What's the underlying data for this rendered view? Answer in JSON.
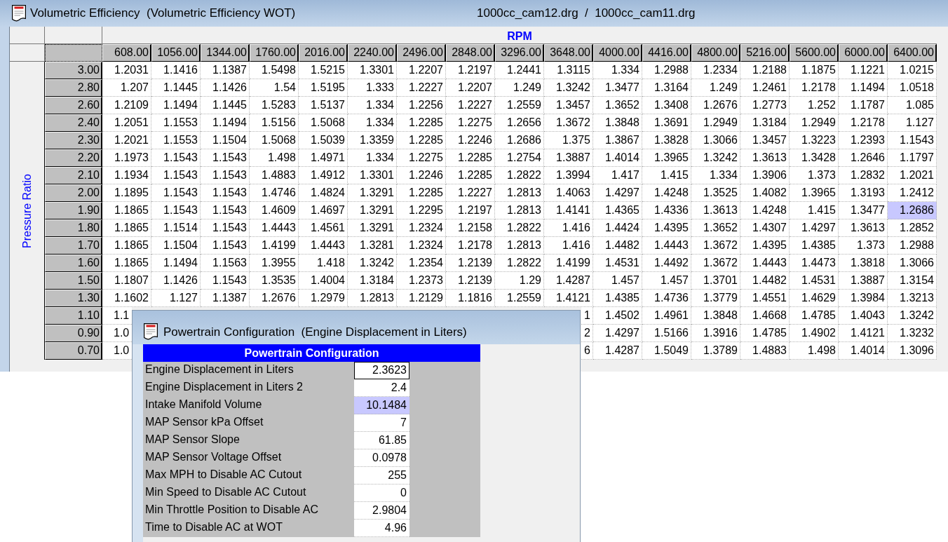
{
  "window": {
    "title": "Volumetric Efficiency  (Volumetric Efficiency WOT)",
    "files": "1000cc_cam12.drg  /  1000cc_cam11.drg"
  },
  "table": {
    "column_axis": "RPM",
    "row_axis": "Pressure Ratio",
    "columns": [
      "608.00",
      "1056.00",
      "1344.00",
      "1760.00",
      "2016.00",
      "2240.00",
      "2496.00",
      "2848.00",
      "3296.00",
      "3648.00",
      "4000.00",
      "4416.00",
      "4800.00",
      "5216.00",
      "5600.00",
      "6000.00",
      "6400.00"
    ],
    "rows": [
      {
        "label": "3.00",
        "kind": "full",
        "cells": [
          {
            "text": "1.2031",
            "selected": false
          },
          {
            "text": "1.1416",
            "selected": false
          },
          {
            "text": "1.1387",
            "selected": false
          },
          {
            "text": "1.5498",
            "selected": false
          },
          {
            "text": "1.5215",
            "selected": false
          },
          {
            "text": "1.3301",
            "selected": false
          },
          {
            "text": "1.2207",
            "selected": false
          },
          {
            "text": "1.2197",
            "selected": false
          },
          {
            "text": "1.2441",
            "selected": false
          },
          {
            "text": "1.3115",
            "selected": false
          },
          {
            "text": "1.334",
            "selected": false
          },
          {
            "text": "1.2988",
            "selected": false
          },
          {
            "text": "1.2334",
            "selected": false
          },
          {
            "text": "1.2188",
            "selected": false
          },
          {
            "text": "1.1875",
            "selected": false
          },
          {
            "text": "1.1221",
            "selected": false
          },
          {
            "text": "1.0215",
            "selected": false
          }
        ]
      },
      {
        "label": "2.80",
        "kind": "full",
        "cells": [
          {
            "text": "1.207",
            "selected": false
          },
          {
            "text": "1.1445",
            "selected": false
          },
          {
            "text": "1.1426",
            "selected": false
          },
          {
            "text": "1.54",
            "selected": false
          },
          {
            "text": "1.5195",
            "selected": false
          },
          {
            "text": "1.333",
            "selected": false
          },
          {
            "text": "1.2227",
            "selected": false
          },
          {
            "text": "1.2207",
            "selected": false
          },
          {
            "text": "1.249",
            "selected": false
          },
          {
            "text": "1.3242",
            "selected": false
          },
          {
            "text": "1.3477",
            "selected": false
          },
          {
            "text": "1.3164",
            "selected": false
          },
          {
            "text": "1.249",
            "selected": false
          },
          {
            "text": "1.2461",
            "selected": false
          },
          {
            "text": "1.2178",
            "selected": false
          },
          {
            "text": "1.1494",
            "selected": false
          },
          {
            "text": "1.0518",
            "selected": false
          }
        ]
      },
      {
        "label": "2.60",
        "kind": "full",
        "cells": [
          {
            "text": "1.2109",
            "selected": false
          },
          {
            "text": "1.1494",
            "selected": false
          },
          {
            "text": "1.1445",
            "selected": false
          },
          {
            "text": "1.5283",
            "selected": false
          },
          {
            "text": "1.5137",
            "selected": false
          },
          {
            "text": "1.334",
            "selected": false
          },
          {
            "text": "1.2256",
            "selected": false
          },
          {
            "text": "1.2227",
            "selected": false
          },
          {
            "text": "1.2559",
            "selected": false
          },
          {
            "text": "1.3457",
            "selected": false
          },
          {
            "text": "1.3652",
            "selected": false
          },
          {
            "text": "1.3408",
            "selected": false
          },
          {
            "text": "1.2676",
            "selected": false
          },
          {
            "text": "1.2773",
            "selected": false
          },
          {
            "text": "1.252",
            "selected": false
          },
          {
            "text": "1.1787",
            "selected": false
          },
          {
            "text": "1.085",
            "selected": false
          }
        ]
      },
      {
        "label": "2.40",
        "kind": "full",
        "cells": [
          {
            "text": "1.2051",
            "selected": false
          },
          {
            "text": "1.1553",
            "selected": false
          },
          {
            "text": "1.1494",
            "selected": false
          },
          {
            "text": "1.5156",
            "selected": false
          },
          {
            "text": "1.5068",
            "selected": false
          },
          {
            "text": "1.334",
            "selected": false
          },
          {
            "text": "1.2285",
            "selected": false
          },
          {
            "text": "1.2275",
            "selected": false
          },
          {
            "text": "1.2656",
            "selected": false
          },
          {
            "text": "1.3672",
            "selected": false
          },
          {
            "text": "1.3848",
            "selected": false
          },
          {
            "text": "1.3691",
            "selected": false
          },
          {
            "text": "1.2949",
            "selected": false
          },
          {
            "text": "1.3184",
            "selected": false
          },
          {
            "text": "1.2949",
            "selected": false
          },
          {
            "text": "1.2178",
            "selected": false
          },
          {
            "text": "1.127",
            "selected": false
          }
        ]
      },
      {
        "label": "2.30",
        "kind": "full",
        "cells": [
          {
            "text": "1.2021",
            "selected": false
          },
          {
            "text": "1.1553",
            "selected": false
          },
          {
            "text": "1.1504",
            "selected": false
          },
          {
            "text": "1.5068",
            "selected": false
          },
          {
            "text": "1.5039",
            "selected": false
          },
          {
            "text": "1.3359",
            "selected": false
          },
          {
            "text": "1.2285",
            "selected": false
          },
          {
            "text": "1.2246",
            "selected": false
          },
          {
            "text": "1.2686",
            "selected": false
          },
          {
            "text": "1.375",
            "selected": false
          },
          {
            "text": "1.3867",
            "selected": false
          },
          {
            "text": "1.3828",
            "selected": false
          },
          {
            "text": "1.3066",
            "selected": false
          },
          {
            "text": "1.3457",
            "selected": false
          },
          {
            "text": "1.3223",
            "selected": false
          },
          {
            "text": "1.2393",
            "selected": false
          },
          {
            "text": "1.1543",
            "selected": false
          }
        ]
      },
      {
        "label": "2.20",
        "kind": "full",
        "cells": [
          {
            "text": "1.1973",
            "selected": false
          },
          {
            "text": "1.1543",
            "selected": false
          },
          {
            "text": "1.1543",
            "selected": false
          },
          {
            "text": "1.498",
            "selected": false
          },
          {
            "text": "1.4971",
            "selected": false
          },
          {
            "text": "1.334",
            "selected": false
          },
          {
            "text": "1.2275",
            "selected": false
          },
          {
            "text": "1.2285",
            "selected": false
          },
          {
            "text": "1.2754",
            "selected": false
          },
          {
            "text": "1.3887",
            "selected": false
          },
          {
            "text": "1.4014",
            "selected": false
          },
          {
            "text": "1.3965",
            "selected": false
          },
          {
            "text": "1.3242",
            "selected": false
          },
          {
            "text": "1.3613",
            "selected": false
          },
          {
            "text": "1.3428",
            "selected": false
          },
          {
            "text": "1.2646",
            "selected": false
          },
          {
            "text": "1.1797",
            "selected": false
          }
        ]
      },
      {
        "label": "2.10",
        "kind": "full",
        "cells": [
          {
            "text": "1.1934",
            "selected": false
          },
          {
            "text": "1.1543",
            "selected": false
          },
          {
            "text": "1.1543",
            "selected": false
          },
          {
            "text": "1.4883",
            "selected": false
          },
          {
            "text": "1.4912",
            "selected": false
          },
          {
            "text": "1.3301",
            "selected": false
          },
          {
            "text": "1.2246",
            "selected": false
          },
          {
            "text": "1.2285",
            "selected": false
          },
          {
            "text": "1.2822",
            "selected": false
          },
          {
            "text": "1.3994",
            "selected": false
          },
          {
            "text": "1.417",
            "selected": false
          },
          {
            "text": "1.415",
            "selected": false
          },
          {
            "text": "1.334",
            "selected": false
          },
          {
            "text": "1.3906",
            "selected": false
          },
          {
            "text": "1.373",
            "selected": false
          },
          {
            "text": "1.2832",
            "selected": false
          },
          {
            "text": "1.2021",
            "selected": false
          }
        ]
      },
      {
        "label": "2.00",
        "kind": "full",
        "cells": [
          {
            "text": "1.1895",
            "selected": false
          },
          {
            "text": "1.1543",
            "selected": false
          },
          {
            "text": "1.1543",
            "selected": false
          },
          {
            "text": "1.4746",
            "selected": false
          },
          {
            "text": "1.4824",
            "selected": false
          },
          {
            "text": "1.3291",
            "selected": false
          },
          {
            "text": "1.2285",
            "selected": false
          },
          {
            "text": "1.2227",
            "selected": false
          },
          {
            "text": "1.2813",
            "selected": false
          },
          {
            "text": "1.4063",
            "selected": false
          },
          {
            "text": "1.4297",
            "selected": false
          },
          {
            "text": "1.4248",
            "selected": false
          },
          {
            "text": "1.3525",
            "selected": false
          },
          {
            "text": "1.4082",
            "selected": false
          },
          {
            "text": "1.3965",
            "selected": false
          },
          {
            "text": "1.3193",
            "selected": false
          },
          {
            "text": "1.2412",
            "selected": false
          }
        ]
      },
      {
        "label": "1.90",
        "kind": "full",
        "cells": [
          {
            "text": "1.1865",
            "selected": false
          },
          {
            "text": "1.1543",
            "selected": false
          },
          {
            "text": "1.1543",
            "selected": false
          },
          {
            "text": "1.4609",
            "selected": false
          },
          {
            "text": "1.4697",
            "selected": false
          },
          {
            "text": "1.3291",
            "selected": false
          },
          {
            "text": "1.2295",
            "selected": false
          },
          {
            "text": "1.2197",
            "selected": false
          },
          {
            "text": "1.2813",
            "selected": false
          },
          {
            "text": "1.4141",
            "selected": false
          },
          {
            "text": "1.4365",
            "selected": false
          },
          {
            "text": "1.4336",
            "selected": false
          },
          {
            "text": "1.3613",
            "selected": false
          },
          {
            "text": "1.4248",
            "selected": false
          },
          {
            "text": "1.415",
            "selected": false
          },
          {
            "text": "1.3477",
            "selected": false
          },
          {
            "text": "1.2686",
            "selected": true
          }
        ]
      },
      {
        "label": "1.80",
        "kind": "full",
        "cells": [
          {
            "text": "1.1865",
            "selected": false
          },
          {
            "text": "1.1514",
            "selected": false
          },
          {
            "text": "1.1543",
            "selected": false
          },
          {
            "text": "1.4443",
            "selected": false
          },
          {
            "text": "1.4561",
            "selected": false
          },
          {
            "text": "1.3291",
            "selected": false
          },
          {
            "text": "1.2324",
            "selected": false
          },
          {
            "text": "1.2158",
            "selected": false
          },
          {
            "text": "1.2822",
            "selected": false
          },
          {
            "text": "1.416",
            "selected": false
          },
          {
            "text": "1.4424",
            "selected": false
          },
          {
            "text": "1.4395",
            "selected": false
          },
          {
            "text": "1.3652",
            "selected": false
          },
          {
            "text": "1.4307",
            "selected": false
          },
          {
            "text": "1.4297",
            "selected": false
          },
          {
            "text": "1.3613",
            "selected": false
          },
          {
            "text": "1.2852",
            "selected": false
          }
        ]
      },
      {
        "label": "1.70",
        "kind": "full",
        "cells": [
          {
            "text": "1.1865",
            "selected": false
          },
          {
            "text": "1.1504",
            "selected": false
          },
          {
            "text": "1.1543",
            "selected": false
          },
          {
            "text": "1.4199",
            "selected": false
          },
          {
            "text": "1.4443",
            "selected": false
          },
          {
            "text": "1.3281",
            "selected": false
          },
          {
            "text": "1.2324",
            "selected": false
          },
          {
            "text": "1.2178",
            "selected": false
          },
          {
            "text": "1.2813",
            "selected": false
          },
          {
            "text": "1.416",
            "selected": false
          },
          {
            "text": "1.4482",
            "selected": false
          },
          {
            "text": "1.4443",
            "selected": false
          },
          {
            "text": "1.3672",
            "selected": false
          },
          {
            "text": "1.4395",
            "selected": false
          },
          {
            "text": "1.4385",
            "selected": false
          },
          {
            "text": "1.373",
            "selected": false
          },
          {
            "text": "1.2988",
            "selected": false
          }
        ]
      },
      {
        "label": "1.60",
        "kind": "full",
        "cells": [
          {
            "text": "1.1865",
            "selected": false
          },
          {
            "text": "1.1494",
            "selected": false
          },
          {
            "text": "1.1563",
            "selected": false
          },
          {
            "text": "1.3955",
            "selected": false
          },
          {
            "text": "1.418",
            "selected": false
          },
          {
            "text": "1.3242",
            "selected": false
          },
          {
            "text": "1.2354",
            "selected": false
          },
          {
            "text": "1.2139",
            "selected": false
          },
          {
            "text": "1.2822",
            "selected": false
          },
          {
            "text": "1.4199",
            "selected": false
          },
          {
            "text": "1.4531",
            "selected": false
          },
          {
            "text": "1.4492",
            "selected": false
          },
          {
            "text": "1.3672",
            "selected": false
          },
          {
            "text": "1.4443",
            "selected": false
          },
          {
            "text": "1.4473",
            "selected": false
          },
          {
            "text": "1.3818",
            "selected": false
          },
          {
            "text": "1.3066",
            "selected": false
          }
        ]
      },
      {
        "label": "1.50",
        "kind": "full",
        "cells": [
          {
            "text": "1.1807",
            "selected": false
          },
          {
            "text": "1.1426",
            "selected": false
          },
          {
            "text": "1.1543",
            "selected": false
          },
          {
            "text": "1.3535",
            "selected": false
          },
          {
            "text": "1.4004",
            "selected": false
          },
          {
            "text": "1.3184",
            "selected": false
          },
          {
            "text": "1.2373",
            "selected": false
          },
          {
            "text": "1.2139",
            "selected": false
          },
          {
            "text": "1.29",
            "selected": false
          },
          {
            "text": "1.4287",
            "selected": false
          },
          {
            "text": "1.457",
            "selected": false
          },
          {
            "text": "1.457",
            "selected": false
          },
          {
            "text": "1.3701",
            "selected": false
          },
          {
            "text": "1.4482",
            "selected": false
          },
          {
            "text": "1.4531",
            "selected": false
          },
          {
            "text": "1.3887",
            "selected": false
          },
          {
            "text": "1.3154",
            "selected": false
          }
        ]
      },
      {
        "label": "1.30",
        "kind": "full",
        "cells": [
          {
            "text": "1.1602",
            "selected": false
          },
          {
            "text": "1.127",
            "selected": false
          },
          {
            "text": "1.1387",
            "selected": false
          },
          {
            "text": "1.2676",
            "selected": false
          },
          {
            "text": "1.2979",
            "selected": false
          },
          {
            "text": "1.2813",
            "selected": false
          },
          {
            "text": "1.2129",
            "selected": false
          },
          {
            "text": "1.1816",
            "selected": false
          },
          {
            "text": "1.2559",
            "selected": false
          },
          {
            "text": "1.4121",
            "selected": false
          },
          {
            "text": "1.4385",
            "selected": false
          },
          {
            "text": "1.4736",
            "selected": false
          },
          {
            "text": "1.3779",
            "selected": false
          },
          {
            "text": "1.4551",
            "selected": false
          },
          {
            "text": "1.4629",
            "selected": false
          },
          {
            "text": "1.3984",
            "selected": false
          },
          {
            "text": "1.3213",
            "selected": false
          }
        ]
      },
      {
        "label": "1.10",
        "kind": "covered",
        "cells": [
          {
            "text": "1.1",
            "selected": false
          }
        ],
        "trailing_cells": [
          {
            "text": "1",
            "selected": false
          },
          {
            "text": "1.4502",
            "selected": false
          },
          {
            "text": "1.4961",
            "selected": false
          },
          {
            "text": "1.3848",
            "selected": false
          },
          {
            "text": "1.4668",
            "selected": false
          },
          {
            "text": "1.4785",
            "selected": false
          },
          {
            "text": "1.4043",
            "selected": false
          },
          {
            "text": "1.3242",
            "selected": false
          }
        ]
      },
      {
        "label": "0.90",
        "kind": "covered",
        "cells": [
          {
            "text": "1.0",
            "selected": false
          }
        ],
        "trailing_cells": [
          {
            "text": "2",
            "selected": false
          },
          {
            "text": "1.4297",
            "selected": false
          },
          {
            "text": "1.5166",
            "selected": false
          },
          {
            "text": "1.3916",
            "selected": false
          },
          {
            "text": "1.4785",
            "selected": false
          },
          {
            "text": "1.4902",
            "selected": false
          },
          {
            "text": "1.4121",
            "selected": false
          },
          {
            "text": "1.3232",
            "selected": false
          }
        ]
      },
      {
        "label": "0.70",
        "kind": "covered",
        "cells": [
          {
            "text": "1.0",
            "selected": false
          }
        ],
        "trailing_cells": [
          {
            "text": "6",
            "selected": false
          },
          {
            "text": "1.4287",
            "selected": false
          },
          {
            "text": "1.5049",
            "selected": false
          },
          {
            "text": "1.3789",
            "selected": false
          },
          {
            "text": "1.4883",
            "selected": false
          },
          {
            "text": "1.498",
            "selected": false
          },
          {
            "text": "1.4014",
            "selected": false
          },
          {
            "text": "1.3096",
            "selected": false
          }
        ]
      }
    ]
  },
  "popup": {
    "title": "Powertrain Configuration  (Engine Displacement in Liters)",
    "header": "Powertrain Configuration",
    "rows": [
      {
        "label": "Engine Displacement in Liters",
        "value": "2.3623",
        "selected": false,
        "focused": true
      },
      {
        "label": "Engine Displacement in Liters 2",
        "value": "2.4",
        "selected": false,
        "focused": false
      },
      {
        "label": "Intake Manifold Volume",
        "value": "10.1484",
        "selected": true,
        "focused": false
      },
      {
        "label": "MAP Sensor kPa Offset",
        "value": "7",
        "selected": false,
        "focused": false
      },
      {
        "label": "MAP Sensor Slope",
        "value": "61.85",
        "selected": false,
        "focused": false
      },
      {
        "label": "MAP Sensor Voltage Offset",
        "value": "0.0978",
        "selected": false,
        "focused": false
      },
      {
        "label": "Max MPH to Disable AC Cutout",
        "value": "255",
        "selected": false,
        "focused": false
      },
      {
        "label": "Min Speed to Disable AC Cutout",
        "value": "0",
        "selected": false,
        "focused": false
      },
      {
        "label": "Min Throttle Position to Disable AC",
        "value": "2.9804",
        "selected": false,
        "focused": false
      },
      {
        "label": "Time to Disable AC at WOT",
        "value": "4.96",
        "selected": false,
        "focused": false
      }
    ]
  }
}
